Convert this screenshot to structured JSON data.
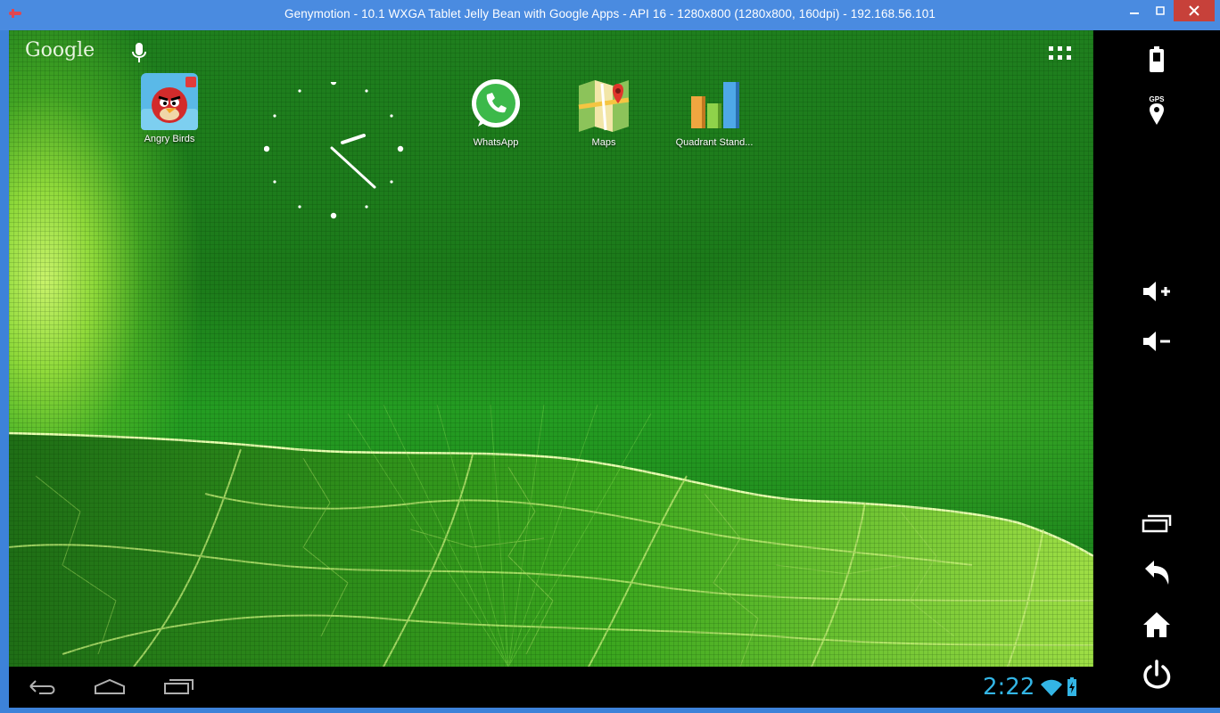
{
  "window": {
    "title": "Genymotion - 10.1 WXGA Tablet Jelly Bean with Google Apps - API 16 - 1280x800 (1280x800, 160dpi) - 192.168.56.101",
    "controls": [
      "minimize",
      "maximize",
      "close"
    ]
  },
  "home": {
    "search_label": "Google",
    "apps": [
      {
        "label": "Angry Birds",
        "icon": "angry-birds-icon"
      },
      {
        "label": "WhatsApp",
        "icon": "whatsapp-icon"
      },
      {
        "label": "Maps",
        "icon": "maps-icon"
      },
      {
        "label": "Quadrant Stand...",
        "icon": "quadrant-icon"
      }
    ]
  },
  "statusbar": {
    "time": "2:22"
  },
  "colors": {
    "title_bar": "#4a8be0",
    "close_button": "#c7413a",
    "clock_accent": "#33b5e5",
    "wallpaper_green": "#1f7a1c"
  },
  "sidebar": {
    "buttons": [
      "battery-icon",
      "gps-icon",
      "volume-up-icon",
      "volume-down-icon",
      "recent-apps-icon",
      "back-icon",
      "home-icon",
      "power-icon"
    ],
    "gps_label": "GPS"
  }
}
